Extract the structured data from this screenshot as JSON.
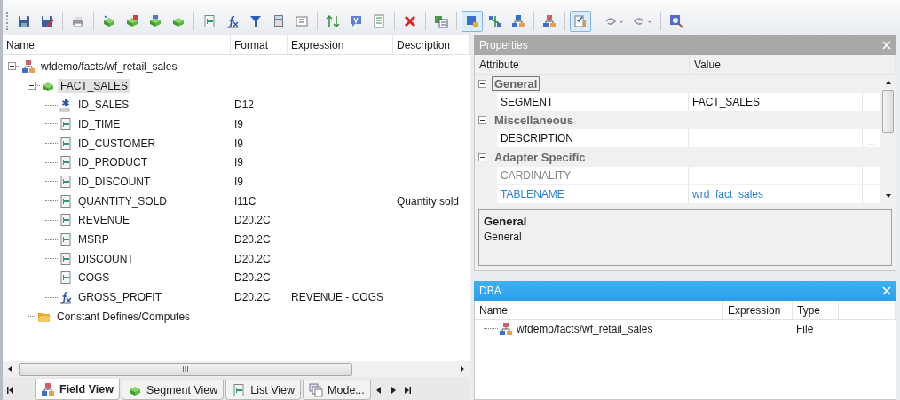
{
  "toolbar": {
    "groups": [
      [
        {
          "kind": "save",
          "pressed": false
        },
        {
          "kind": "save-as",
          "pressed": false
        }
      ],
      [
        {
          "kind": "print",
          "pressed": false
        }
      ],
      [
        {
          "kind": "segment-new",
          "pressed": false
        },
        {
          "kind": "segment-join",
          "pressed": false
        },
        {
          "kind": "segment-ref",
          "pressed": false
        },
        {
          "kind": "segment",
          "pressed": false
        }
      ],
      [
        {
          "kind": "field",
          "pressed": false
        },
        {
          "kind": "compute",
          "pressed": false
        },
        {
          "kind": "filter",
          "pressed": false
        },
        {
          "kind": "calculator",
          "pressed": false
        },
        {
          "kind": "form",
          "pressed": false
        }
      ],
      [
        {
          "kind": "sort",
          "pressed": false
        },
        {
          "kind": "variable",
          "pressed": false
        },
        {
          "kind": "list",
          "pressed": false
        }
      ],
      [
        {
          "kind": "delete",
          "pressed": false
        }
      ],
      [
        {
          "kind": "copy",
          "pressed": false
        }
      ],
      [
        {
          "kind": "db-lock",
          "pressed": true
        },
        {
          "kind": "diagram",
          "pressed": false
        },
        {
          "kind": "tree-view",
          "pressed": false
        }
      ],
      [
        {
          "kind": "hierarchy",
          "pressed": false
        }
      ],
      [
        {
          "kind": "checklist",
          "pressed": true
        }
      ],
      [
        {
          "kind": "undo",
          "pressed": false
        },
        {
          "kind": "redo",
          "pressed": false
        }
      ],
      [
        {
          "kind": "search",
          "pressed": false
        }
      ]
    ]
  },
  "field_view": {
    "columns": [
      "Name",
      "Format",
      "Expression",
      "Description"
    ],
    "tree": [
      {
        "kind": "file",
        "name": "wfdemo/facts/wf_retail_sales",
        "expanded": true,
        "selected": false,
        "children": [
          {
            "kind": "segment",
            "name": "FACT_SALES",
            "expanded": true,
            "selected": true,
            "children": [
              {
                "kind": "key",
                "name": "ID_SALES",
                "format": "D12",
                "selected": false
              },
              {
                "kind": "field",
                "name": "ID_TIME",
                "format": "I9",
                "selected": false
              },
              {
                "kind": "field",
                "name": "ID_CUSTOMER",
                "format": "I9",
                "selected": false
              },
              {
                "kind": "field",
                "name": "ID_PRODUCT",
                "format": "I9",
                "selected": false
              },
              {
                "kind": "field",
                "name": "ID_DISCOUNT",
                "format": "I9",
                "selected": false
              },
              {
                "kind": "field",
                "name": "QUANTITY_SOLD",
                "format": "I11C",
                "description": "Quantity sold",
                "selected": false
              },
              {
                "kind": "field",
                "name": "REVENUE",
                "format": "D20.2C",
                "selected": false
              },
              {
                "kind": "field",
                "name": "MSRP",
                "format": "D20.2C",
                "selected": false
              },
              {
                "kind": "field",
                "name": "DISCOUNT",
                "format": "D20.2C",
                "selected": false
              },
              {
                "kind": "field",
                "name": "COGS",
                "format": "D20.2C",
                "selected": false
              },
              {
                "kind": "compute",
                "name": "GROSS_PROFIT",
                "format": "D20.2C",
                "expression": "REVENUE - COGS",
                "selected": false
              }
            ]
          },
          {
            "kind": "folder",
            "name": "Constant Defines/Computes",
            "selected": false
          }
        ]
      }
    ],
    "scroll_arrow": "III",
    "tabs": [
      {
        "kind": "file",
        "label": "Field View",
        "selected": true
      },
      {
        "kind": "segment",
        "label": "Segment View",
        "selected": false
      },
      {
        "kind": "field",
        "label": "List View",
        "selected": false
      },
      {
        "kind": "windows",
        "label": "Mode...",
        "selected": false
      }
    ]
  },
  "properties": {
    "title": "Properties",
    "columns": [
      "Attribute",
      "Value"
    ],
    "groups": [
      {
        "name": "General",
        "expanded": true,
        "selected": true,
        "rows": [
          {
            "attribute": "SEGMENT",
            "value": "FACT_SALES",
            "readonly": false,
            "modified": false
          }
        ]
      },
      {
        "name": "Miscellaneous",
        "expanded": true,
        "selected": false,
        "rows": [
          {
            "attribute": "DESCRIPTION",
            "readonly": false,
            "modified": false,
            "button": "..."
          }
        ]
      },
      {
        "name": "Adapter Specific",
        "expanded": true,
        "selected": false,
        "rows": [
          {
            "attribute": "CARDINALITY",
            "readonly": true,
            "modified": false
          },
          {
            "attribute": "TABLENAME",
            "value": "wrd_fact_sales",
            "readonly": false,
            "modified": true
          }
        ]
      }
    ],
    "help_title": "General",
    "help_text": "General"
  },
  "dba": {
    "title": "DBA",
    "columns": [
      "Name",
      "Expression",
      "Type"
    ],
    "rows": [
      {
        "name": "wfdemo/facts/wf_retail_sales",
        "type": "File"
      }
    ]
  }
}
